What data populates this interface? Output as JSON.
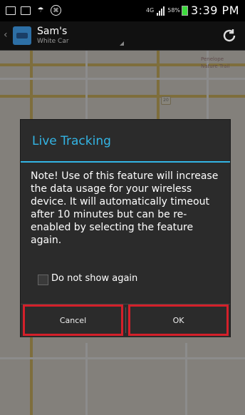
{
  "status_bar": {
    "network": "4G",
    "battery": "58%",
    "time": "3:39 PM"
  },
  "action_bar": {
    "title": "Sam's",
    "subtitle": "White Car"
  },
  "map": {
    "labels": [
      "Penelope",
      "Nature Trail"
    ],
    "shield": "20"
  },
  "dialog": {
    "title": "Live Tracking",
    "message": "Note! Use of this feature will increase the data usage for your wireless device. It will automatically timeout after 10 minutes but can be re-enabled by selecting the feature again.",
    "checkbox_label": "Do not show again",
    "checkbox_checked": false,
    "cancel_label": "Cancel",
    "ok_label": "OK"
  },
  "colors": {
    "accent": "#33b5e5",
    "highlight": "#d4202a"
  }
}
